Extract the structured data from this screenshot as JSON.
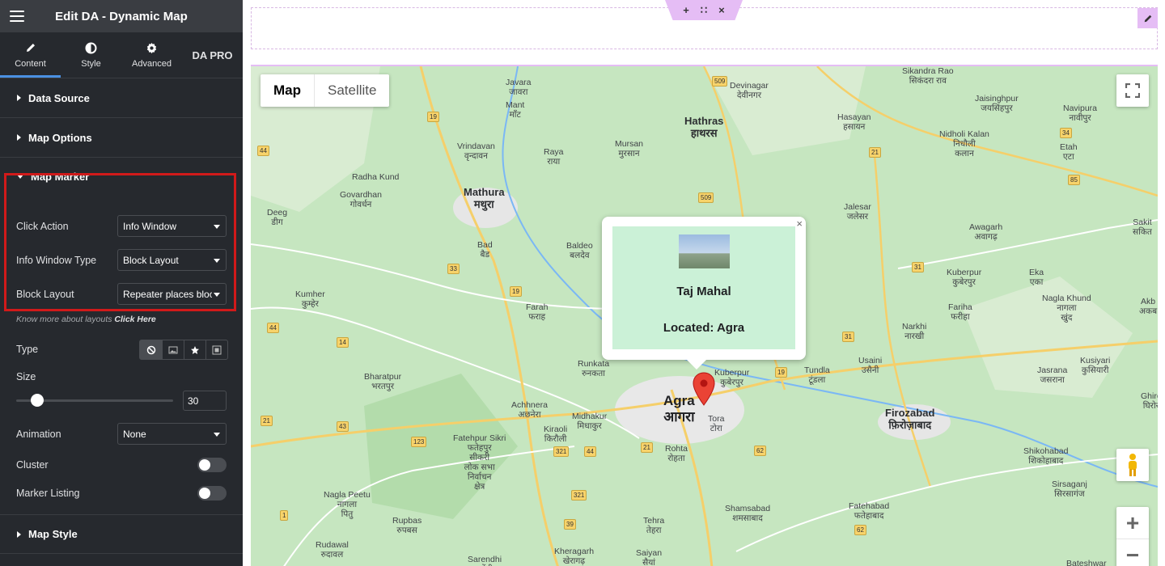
{
  "editor": {
    "title": "Edit  DA - Dynamic Map",
    "tabs": [
      {
        "label": "Content",
        "icon": "pencil-icon"
      },
      {
        "label": "Style",
        "icon": "half-circle-icon"
      },
      {
        "label": "Advanced",
        "icon": "gear-icon"
      },
      {
        "label": "DA PRO"
      }
    ],
    "sections": {
      "data_source": "Data Source",
      "map_options": "Map Options",
      "map_marker": "Map Marker",
      "map_style": "Map Style"
    },
    "marker": {
      "click_action_label": "Click Action",
      "click_action_value": "Info Window",
      "info_window_type_label": "Info Window Type",
      "info_window_type_value": "Block Layout",
      "block_layout_label": "Block Layout",
      "block_layout_value": "Repeater places bloc",
      "hint_text": "Know more about layouts ",
      "hint_link": "Click Here",
      "type_label": "Type",
      "size_label": "Size",
      "size_value": "30",
      "size_fraction": 0.1,
      "animation_label": "Animation",
      "animation_value": "None",
      "cluster_label": "Cluster",
      "cluster_on": false,
      "listing_label": "Marker Listing",
      "listing_on": false
    },
    "accent_color": "#4a90e2",
    "highlight_color": "#d11a1a"
  },
  "map": {
    "type_map": "Map",
    "type_satellite": "Satellite",
    "info_window": {
      "title": "Taj Mahal",
      "located": "Located:  Agra",
      "bg_color": "#cbf1d7"
    },
    "labels": [
      {
        "t": "Javara\nजावरा"
      },
      {
        "t": "Mant\nमाँट"
      },
      {
        "t": "Vrindavan\nवृन्दावन"
      },
      {
        "t": "Raya\nराया"
      },
      {
        "t": "Mursan\nमुरसान"
      },
      {
        "t": "Devinagar\nदेवीनगर"
      },
      {
        "t": "Hasayan\nहसायन"
      },
      {
        "t": "Sikandra Rao\nसिकंदरा राव"
      },
      {
        "t": "Jaisinghpur\nजयसिंहपुर"
      },
      {
        "t": "Navipura\nनावीपुर"
      },
      {
        "t": "Nidholi Kalan\nनिधौली\nकलान"
      },
      {
        "t": "Etah\nएटा"
      },
      {
        "t": "Radha Kund"
      },
      {
        "t": "Govardhan\nगोवर्धन"
      },
      {
        "t": "Deeg\nडीग"
      },
      {
        "t": "Jalesar\nजलेसर"
      },
      {
        "t": "Awagarh\nअवागढ़"
      },
      {
        "t": "Sakit\nसकित"
      },
      {
        "t": "Bad\nबैड"
      },
      {
        "t": "Baldeo\nबलदेव"
      },
      {
        "t": "Kuberpur\nकुबेरपुर"
      },
      {
        "t": "Eka\nएका"
      },
      {
        "t": "Kumher\nकुम्हेर"
      },
      {
        "t": "Farah\nफराह"
      },
      {
        "t": "Fariha\nफरीहा"
      },
      {
        "t": "Nagla Khund\nनागला\nखुंद"
      },
      {
        "t": "Akb\nअकब"
      },
      {
        "t": "Narkhi\nनारखी"
      },
      {
        "t": "Runkata\nरुनकता"
      },
      {
        "t": "Kuberpur\nकुबेरपुर"
      },
      {
        "t": "Tundla\nटूंडला"
      },
      {
        "t": "Usaini\nउसैनी"
      },
      {
        "t": "Jasrana\nजसराना"
      },
      {
        "t": "Kusiyari\nकुसियारी"
      },
      {
        "t": "Bharatpur\nभरतपुर"
      },
      {
        "t": "Achhnera\nअछनेरा"
      },
      {
        "t": "Ghiro\nघिरोर"
      },
      {
        "t": "Midhakur\nमिधाकुर"
      },
      {
        "t": "Tora\nटोरा"
      },
      {
        "t": "Fatehpur Sikri\nफतेहपुर\nसीकरी\nलोक सभा\nनिर्वाचन\nक्षेत्र"
      },
      {
        "t": "Kiraoli\nकिरौली"
      },
      {
        "t": "Rohta\nरोहता"
      },
      {
        "t": "Shikohabad\nशिकोहाबाद"
      },
      {
        "t": "Sirsaganj\nसिरसागंज"
      },
      {
        "t": "Nagla Peetu\nनागला\nपितु"
      },
      {
        "t": "Shamsabad\nशमसाबाद"
      },
      {
        "t": "Fatehabad\nफतेहाबाद"
      },
      {
        "t": "Rupbas\nरुपबस"
      },
      {
        "t": "Tehra\nतेहरा"
      },
      {
        "t": "Rudawal\nरुदावल"
      },
      {
        "t": "Sarendhi\nसरेंढी"
      },
      {
        "t": "Kheragarh\nखेरागढ़"
      },
      {
        "t": "Saiyan\nसैयां"
      },
      {
        "t": "Bateshwar"
      }
    ],
    "cities": [
      {
        "t": "Hathras\nहाथरस"
      },
      {
        "t": "Mathura\nमथुरा"
      },
      {
        "t": "Firozabad\nफ़िरोज़ाबाद"
      }
    ],
    "main_city": "Agra\nआगरा",
    "shields": [
      "509",
      "19",
      "44",
      "21",
      "85",
      "509",
      "34",
      "33",
      "31",
      "19",
      "44",
      "14",
      "31",
      "19",
      "43",
      "21",
      "123",
      "321",
      "44",
      "21",
      "62",
      "62",
      "321",
      "1",
      "39",
      "62"
    ]
  }
}
